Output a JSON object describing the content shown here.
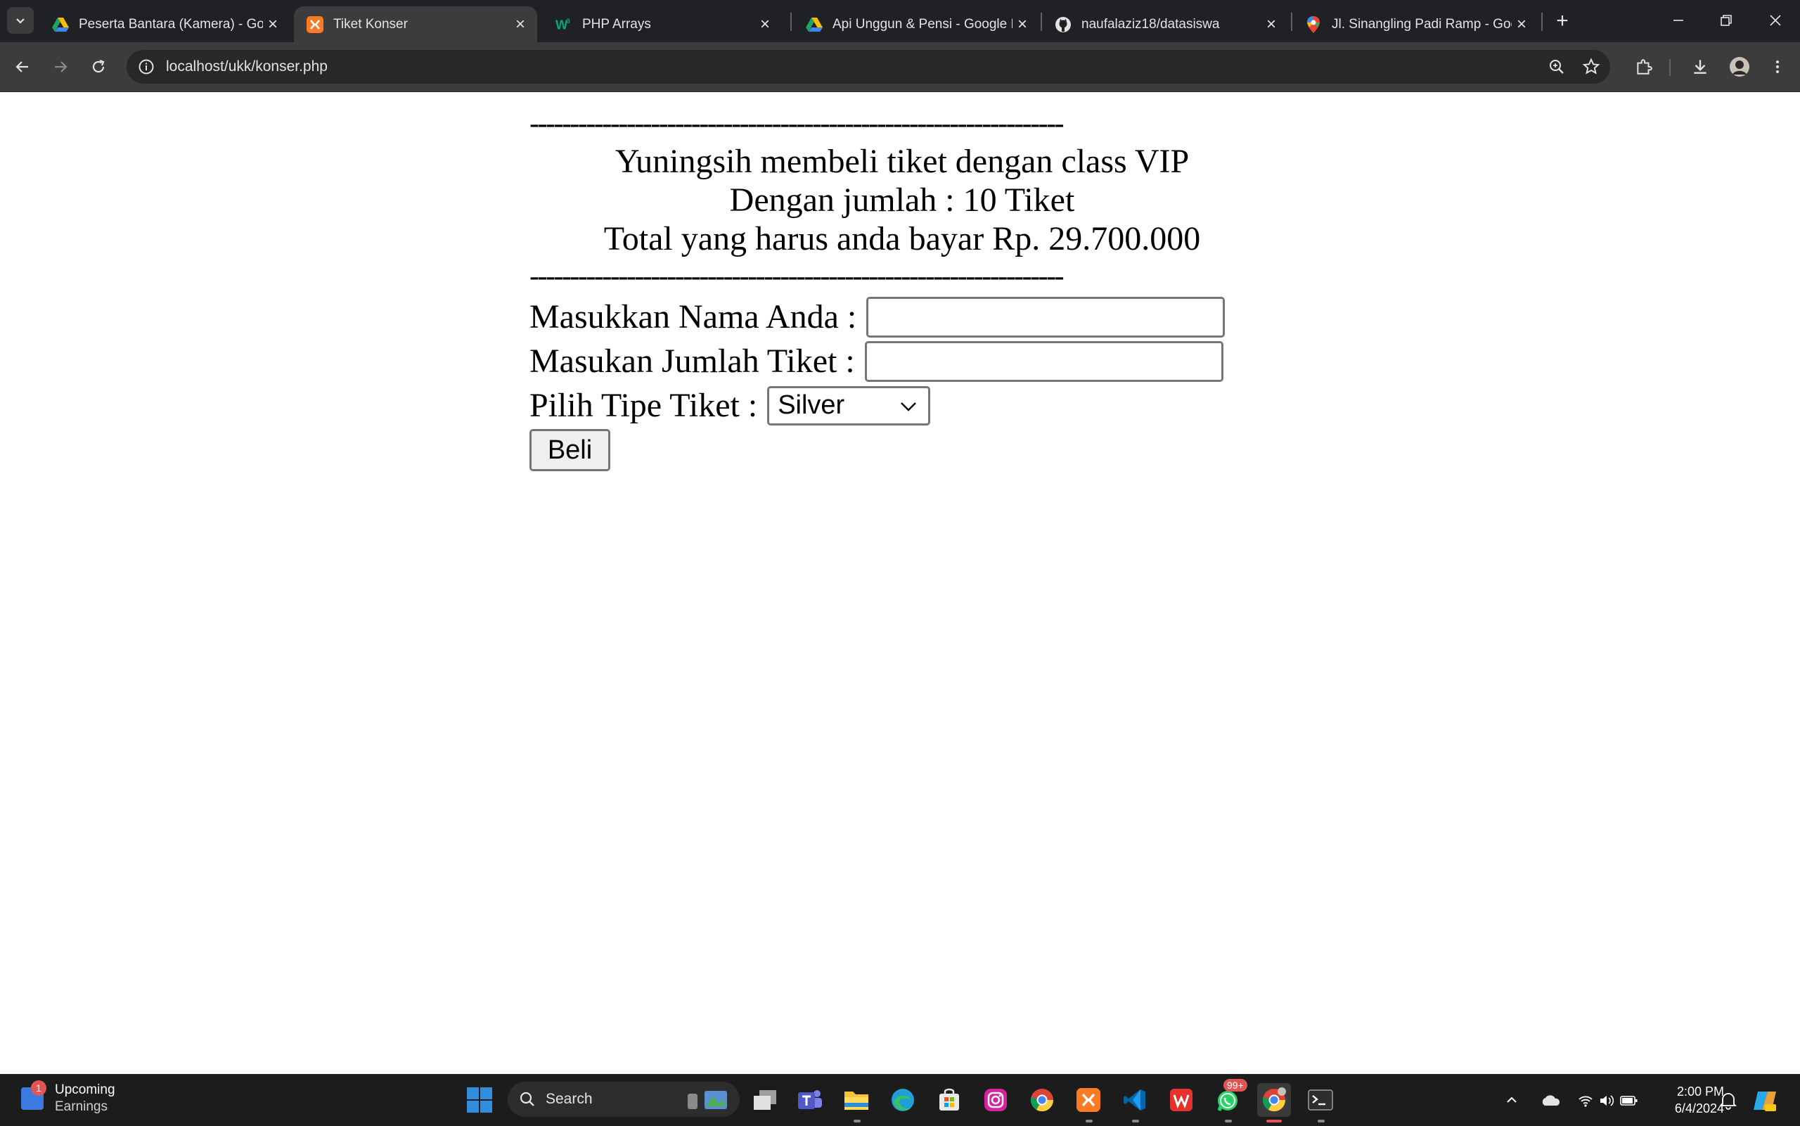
{
  "browser": {
    "tabs": [
      {
        "title": "Peserta Bantara (Kamera) - Goo",
        "favicon": "google-drive-icon"
      },
      {
        "title": "Tiket Konser",
        "favicon": "xampp-icon",
        "active": true
      },
      {
        "title": "PHP Arrays",
        "favicon": "w3schools-icon"
      },
      {
        "title": "Api Unggun & Pensi - Google D",
        "favicon": "google-drive-icon"
      },
      {
        "title": "naufalaziz18/datasiswa",
        "favicon": "github-icon"
      },
      {
        "title": "Jl. Sinangling Padi Ramp - Goo",
        "favicon": "google-maps-icon"
      }
    ],
    "url": "localhost/ukk/konser.php"
  },
  "page": {
    "separator": "------------------------------------------------------------------",
    "result_line1": "Yuningsih membeli tiket dengan class VIP",
    "result_line2": "Dengan jumlah : 10 Tiket",
    "result_line3": "Total yang harus anda bayar Rp. 29.700.000",
    "name_label": "Masukkan Nama Anda :",
    "name_value": "",
    "qty_label": "Masukan Jumlah Tiket :",
    "qty_value": "",
    "type_label": "Pilih Tipe Tiket :",
    "type_selected": "Silver",
    "submit_label": "Beli"
  },
  "taskbar": {
    "widget_title": "Upcoming",
    "widget_subtitle": "Earnings",
    "widget_badge": "1",
    "search_label": "Search",
    "whatsapp_badge": "99+",
    "time": "2:00 PM",
    "date": "6/4/2024"
  },
  "colors": {
    "chrome_dark": "#202124",
    "toolbar": "#3c3c3c",
    "taskbar": "#1c1c1c",
    "accent_windows": "#2f8fdc"
  }
}
